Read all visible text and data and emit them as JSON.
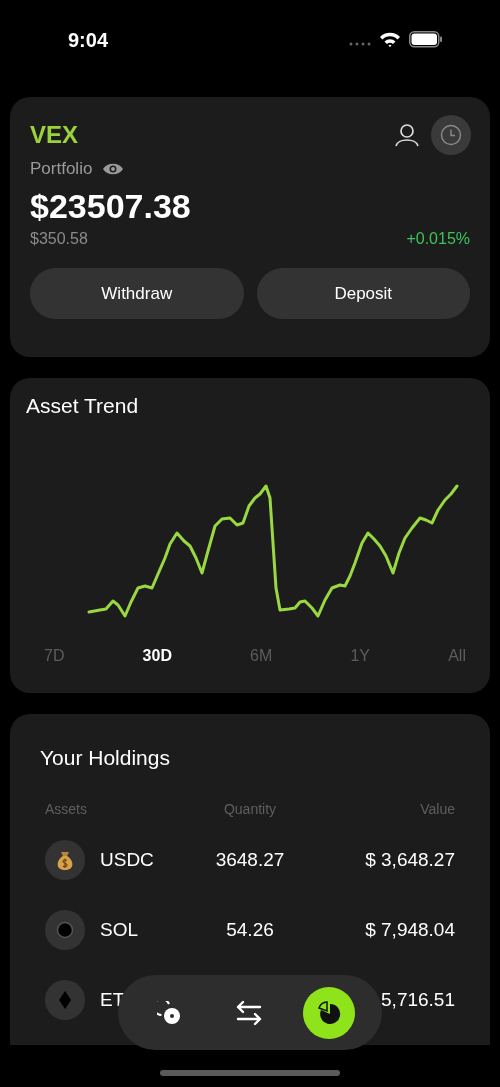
{
  "status_bar": {
    "time": "9:04"
  },
  "portfolio": {
    "brand": "VEX",
    "label": "Portfolio",
    "balance": "$23507.38",
    "change_amount": "$350.58",
    "change_percent": "+0.015%",
    "actions": [
      "Withdraw",
      "Deposit"
    ]
  },
  "trend": {
    "title": "Asset Trend",
    "ranges": [
      {
        "label": "7D",
        "selected": false
      },
      {
        "label": "30D",
        "selected": true
      },
      {
        "label": "6M",
        "selected": false
      },
      {
        "label": "1Y",
        "selected": false
      },
      {
        "label": "All",
        "selected": false
      }
    ]
  },
  "holdings": {
    "title": "Your Holdings",
    "columns": [
      "Assets",
      "Quantity",
      "Value"
    ],
    "rows": [
      {
        "kind": "moneybag",
        "name": "USDC",
        "quantity": "3648.27",
        "value": "$ 3,648.27"
      },
      {
        "kind": "ring",
        "name": "SOL",
        "quantity": "54.26",
        "value": "$ 7,948.04"
      },
      {
        "kind": "diamond",
        "name": "ET",
        "value": "5,716.51"
      }
    ]
  },
  "tab_bar": {
    "items": [
      {
        "kind": "coins",
        "selected": false
      },
      {
        "kind": "swap",
        "selected": false
      },
      {
        "kind": "pie",
        "selected": true
      }
    ]
  }
}
